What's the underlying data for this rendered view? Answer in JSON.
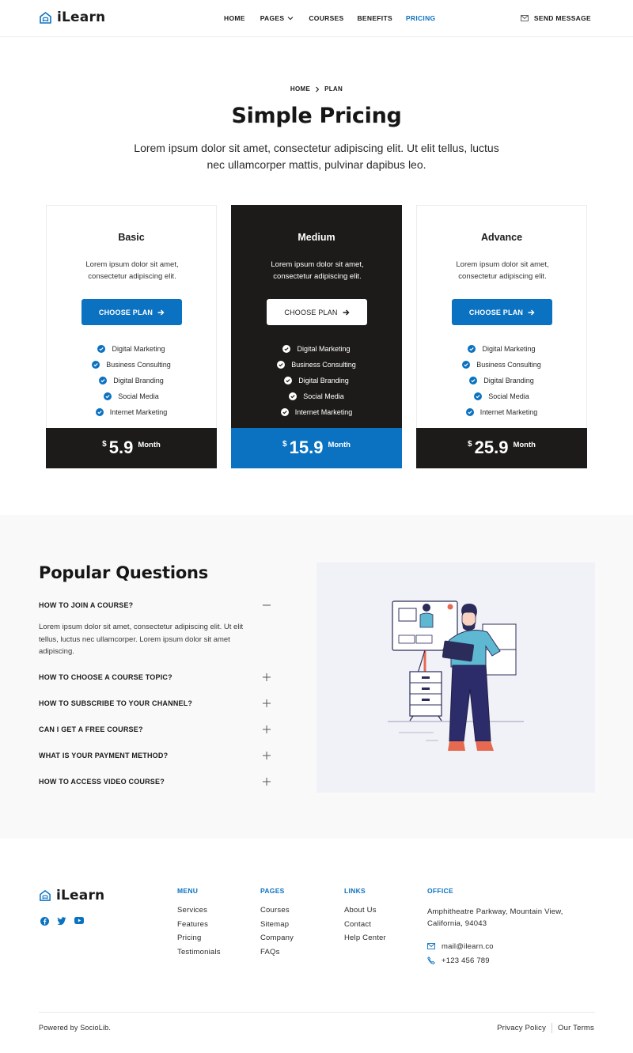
{
  "brand": {
    "name": "iLearn",
    "accent": "#0b72c1",
    "dark": "#1c1b1a"
  },
  "header": {
    "nav": [
      {
        "label": "HOME",
        "active": false
      },
      {
        "label": "PAGES",
        "active": false,
        "dropdown": true
      },
      {
        "label": "COURSES",
        "active": false
      },
      {
        "label": "BENEFITS",
        "active": false
      },
      {
        "label": "PRICING",
        "active": true
      }
    ],
    "send_message": "SEND MESSAGE"
  },
  "hero": {
    "breadcrumb": [
      "HOME",
      "PLAN"
    ],
    "title": "Simple Pricing",
    "subtitle": "Lorem ipsum dolor sit amet, consectetur adipiscing elit. Ut elit tellus, luctus nec ullamcorper mattis, pulvinar dapibus leo."
  },
  "plans": [
    {
      "name": "Basic",
      "desc": "Lorem ipsum dolor sit amet, consectetur adipiscing elit.",
      "button": "CHOOSE PLAN",
      "features": [
        "Digital Marketing",
        "Business Consulting",
        "Digital Branding",
        "Social Media",
        "Internet Marketing"
      ],
      "currency": "$",
      "price": "5.9",
      "period": "Month"
    },
    {
      "name": "Medium",
      "desc": "Lorem ipsum dolor sit amet, consectetur adipiscing elit.",
      "button": "CHOOSE PLAN",
      "features": [
        "Digital Marketing",
        "Business Consulting",
        "Digital Branding",
        "Social Media",
        "Internet Marketing"
      ],
      "currency": "$",
      "price": "15.9",
      "period": "Month"
    },
    {
      "name": "Advance",
      "desc": "Lorem ipsum dolor sit amet, consectetur adipiscing elit.",
      "button": "CHOOSE PLAN",
      "features": [
        "Digital Marketing",
        "Business Consulting",
        "Digital Branding",
        "Social Media",
        "Internet Marketing"
      ],
      "currency": "$",
      "price": "25.9",
      "period": "Month"
    }
  ],
  "faq": {
    "title": "Popular Questions",
    "items": [
      {
        "q": "HOW TO JOIN A COURSE?",
        "open": true,
        "a": "Lorem ipsum dolor sit amet, consectetur adipiscing elit. Ut elit tellus, luctus nec ullamcorper. Lorem ipsum dolor sit amet adipiscing."
      },
      {
        "q": "HOW TO CHOOSE A COURSE TOPIC?",
        "open": false
      },
      {
        "q": "HOW TO SUBSCRIBE TO YOUR CHANNEL?",
        "open": false
      },
      {
        "q": "CAN I GET A FREE COURSE?",
        "open": false
      },
      {
        "q": "WHAT IS YOUR PAYMENT METHOD?",
        "open": false
      },
      {
        "q": "HOW TO ACCESS VIDEO COURSE?",
        "open": false
      }
    ]
  },
  "footer": {
    "socials": [
      "facebook-icon",
      "twitter-icon",
      "youtube-icon"
    ],
    "menu": {
      "title": "MENU",
      "links": [
        "Services",
        "Features",
        "Pricing",
        "Testimonials"
      ]
    },
    "pages": {
      "title": "PAGES",
      "links": [
        "Courses",
        "Sitemap",
        "Company",
        "FAQs"
      ]
    },
    "links": {
      "title": "LINKS",
      "links": [
        "About Us",
        "Contact",
        "Help Center"
      ]
    },
    "office": {
      "title": "OFFICE",
      "address": "Amphitheatre Parkway, Mountain View, California, 94043",
      "email": "mail@ilearn.co",
      "phone": "+123 456 789"
    },
    "powered": "Powered by SocioLib.",
    "privacy": "Privacy Policy",
    "terms": "Our Terms"
  }
}
